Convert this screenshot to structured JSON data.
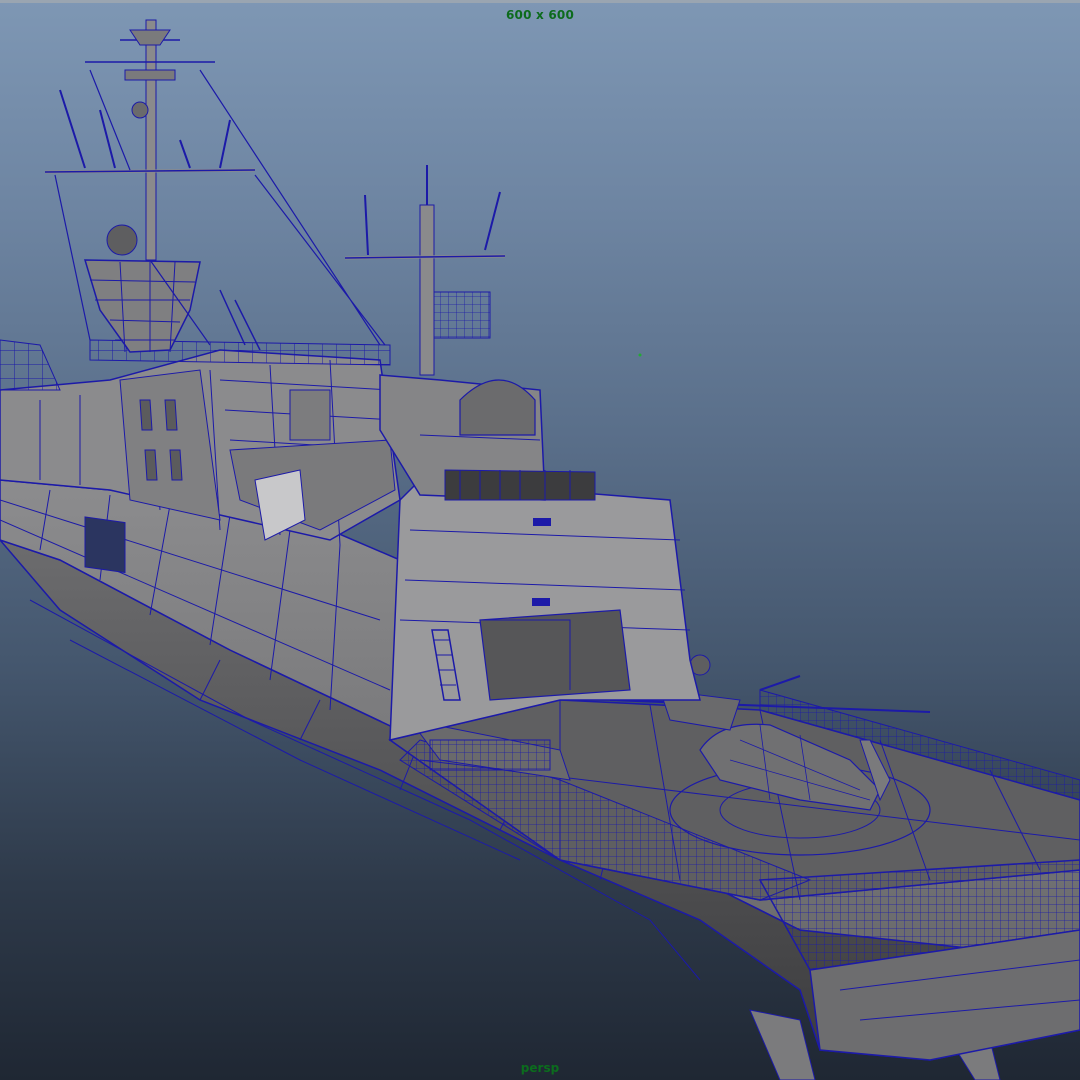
{
  "viewport": {
    "resolution_gate_label": "600 x 600",
    "camera_label": "persp",
    "colors": {
      "wireframe": "#1c1aa8",
      "hull_light": "#8f8f91",
      "hull_mid": "#6e6e70",
      "hull_dark": "#474749",
      "label_green": "#0c6b1c"
    }
  },
  "scene": {
    "object": "ship-3d-model",
    "display_mode": "wireframe-on-shaded"
  }
}
